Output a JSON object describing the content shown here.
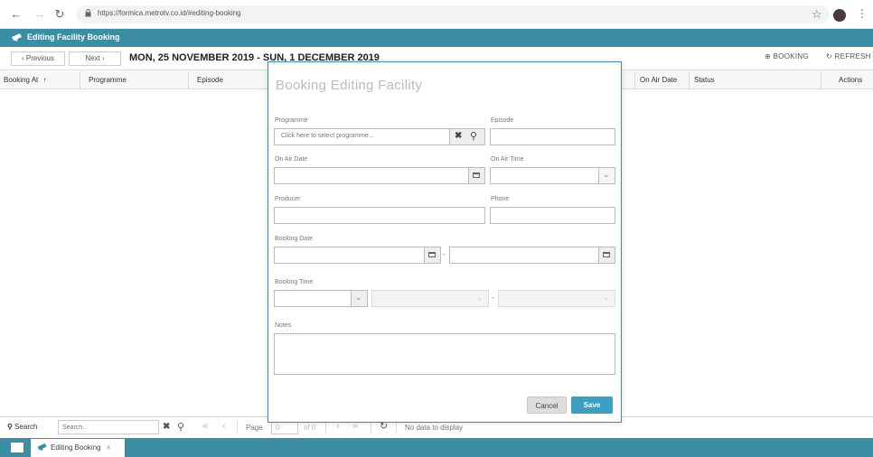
{
  "browser": {
    "url": "https://formica.metrotv.co.id/#editing-booking"
  },
  "app": {
    "title": "Editing Facility Booking"
  },
  "toolbar": {
    "previous_label": "Previous",
    "next_label": "Next",
    "week_title": "MON, 25 NOVEMBER 2019 - SUN, 1 DECEMBER 2019",
    "booking_label": "BOOKING",
    "refresh_label": "REFRESH"
  },
  "grid": {
    "columns": [
      "Booking At",
      "Programme",
      "Episode",
      "On Air Date",
      "Status",
      "Actions"
    ]
  },
  "modal": {
    "title": "Booking Editing Facility",
    "programme_label": "Programme",
    "programme_placeholder": "Click here to select programme...",
    "episode_label": "Episode",
    "on_air_date_label": "On Air Date",
    "on_air_time_label": "On Air Time",
    "producer_label": "Producer",
    "phone_label": "Phone",
    "booking_date_label": "Booking Date",
    "booking_time_label": "Booking Time",
    "notes_label": "Notes",
    "range_separator": "-",
    "cancel_label": "Cancel",
    "save_label": "Save"
  },
  "pager": {
    "search_label": "Search",
    "search_placeholder": "Search...",
    "page_label": "Page",
    "page_value": "0",
    "of_label": "of 0",
    "status_text": "No data to display"
  },
  "taskbar": {
    "tab_label": "Editing Booking",
    "close_glyph": "×"
  },
  "colors": {
    "brand": "#3a8da3",
    "save_button": "#3a9fc0"
  }
}
